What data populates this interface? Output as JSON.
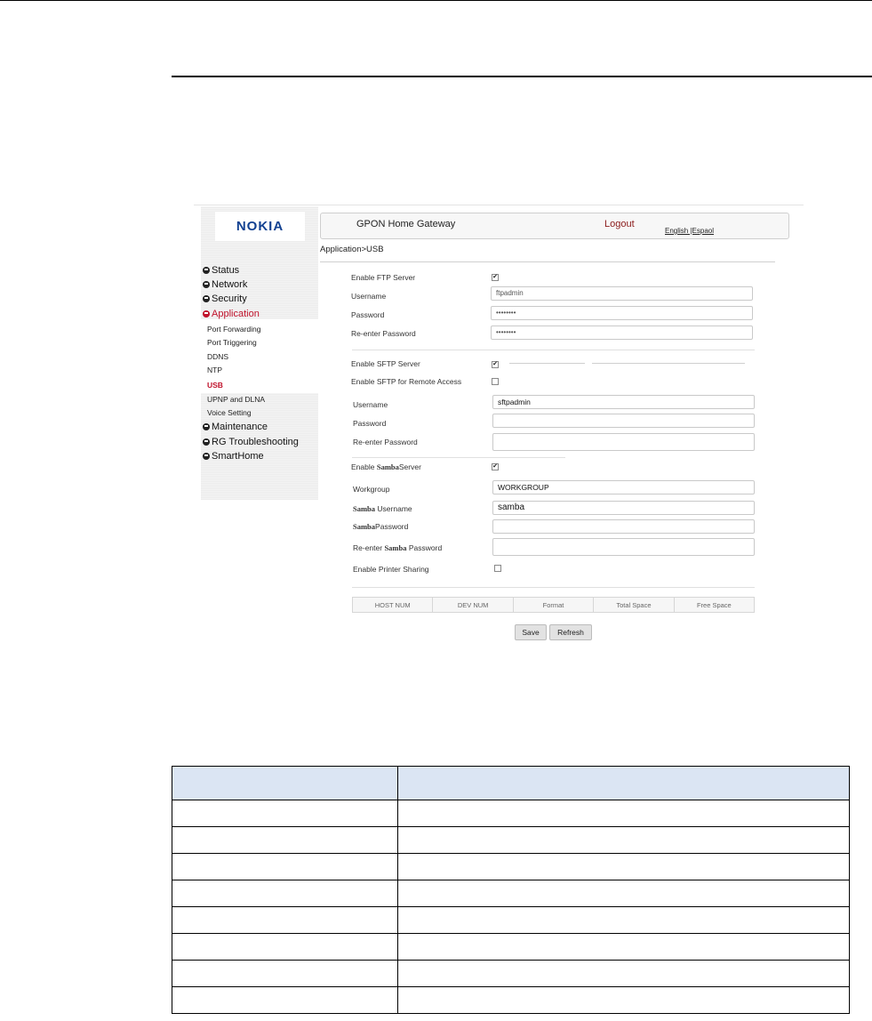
{
  "sidebar": {
    "logo": "NOKIA",
    "menu": [
      {
        "label": "Status",
        "type": "main"
      },
      {
        "label": "Network",
        "type": "main"
      },
      {
        "label": "Security",
        "type": "main"
      },
      {
        "label": "Application",
        "type": "main",
        "active": true
      },
      {
        "label": "Port Forwarding",
        "type": "sub"
      },
      {
        "label": "Port Triggering",
        "type": "sub"
      },
      {
        "label": "DDNS",
        "type": "sub"
      },
      {
        "label": "NTP",
        "type": "sub"
      },
      {
        "label": "USB",
        "type": "sub",
        "current": true
      },
      {
        "label": "UPNP and DLNA",
        "type": "sub"
      },
      {
        "label": "Voice Setting",
        "type": "sub"
      },
      {
        "label": "Maintenance",
        "type": "main"
      },
      {
        "label": "RG Troubleshooting",
        "type": "main"
      },
      {
        "label": "SmartHome",
        "type": "main"
      }
    ]
  },
  "header": {
    "title": "GPON Home Gateway",
    "logout": "Logout",
    "languages": "English |Espaol"
  },
  "breadcrumb": "Application>USB",
  "ftp": {
    "enable_label": "Enable FTP Server",
    "enabled": true,
    "username_label": "Username",
    "username_value": "ftpadmin",
    "password_label": "Password",
    "password_value": "••••••••",
    "reenter_label": "Re-enter Password",
    "reenter_value": "••••••••"
  },
  "sftp": {
    "enable_label": "Enable SFTP Server",
    "enabled": true,
    "remote_label": "Enable SFTP for Remote Access",
    "remote_enabled": false,
    "username_label": "Username",
    "username_value": "sftpadmin",
    "password_label": "Password",
    "password_value": "",
    "reenter_label": "Re-enter Password",
    "reenter_value": ""
  },
  "samba": {
    "enable_prefix": "Enable",
    "enable_brand": "Samba",
    "enable_suffix": "Server",
    "enabled": true,
    "workgroup_label": "Workgroup",
    "workgroup_value": "WORKGROUP",
    "username_brand": "Samba",
    "username_suffix": "Username",
    "username_value": "samba",
    "password_brand": "Samba",
    "password_suffix": "Password",
    "password_value": "",
    "reenter_prefix": "Re-enter",
    "reenter_brand": "Samba",
    "reenter_suffix": "Password",
    "reenter_value": "",
    "printer_label": "Enable Printer Sharing",
    "printer_enabled": false
  },
  "usb_table": {
    "columns": [
      "HOST NUM",
      "DEV NUM",
      "Format",
      "Total Space",
      "Free Space"
    ]
  },
  "buttons": {
    "save": "Save",
    "refresh": "Refresh"
  }
}
